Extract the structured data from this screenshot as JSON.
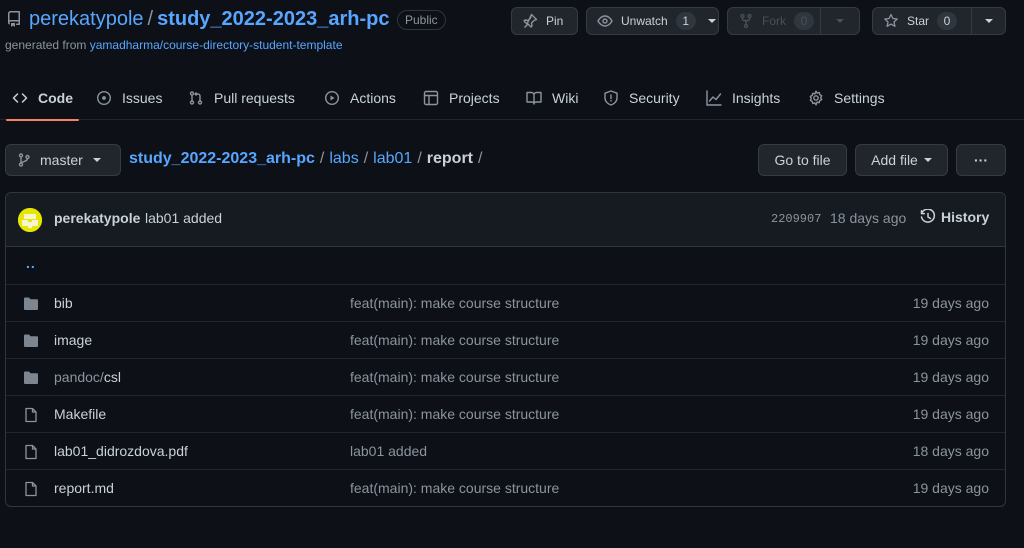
{
  "repo": {
    "owner": "perekatypole",
    "separator": "/",
    "name": "study_2022-2023_arh-pc",
    "visibility": "Public",
    "generated_prefix": "generated from ",
    "template": "yamadharma/course-directory-student-template"
  },
  "actions": {
    "pin": "Pin",
    "watch": "Unwatch",
    "watch_count": "1",
    "fork": "Fork",
    "fork_count": "0",
    "star": "Star",
    "star_count": "0"
  },
  "nav": {
    "tabs": [
      {
        "label": "Code",
        "icon": "code-icon",
        "active": true
      },
      {
        "label": "Issues",
        "icon": "issue-icon"
      },
      {
        "label": "Pull requests",
        "icon": "pull-request-icon"
      },
      {
        "label": "Actions",
        "icon": "play-icon"
      },
      {
        "label": "Projects",
        "icon": "table-icon"
      },
      {
        "label": "Wiki",
        "icon": "book-icon"
      },
      {
        "label": "Security",
        "icon": "shield-icon"
      },
      {
        "label": "Insights",
        "icon": "graph-icon"
      },
      {
        "label": "Settings",
        "icon": "gear-icon"
      }
    ]
  },
  "filenav": {
    "branch": "master",
    "breadcrumb": {
      "repo": "study_2022-2023_arh-pc",
      "path1": "labs",
      "path2": "lab01",
      "current": "report",
      "sep": "/"
    },
    "go_to_file": "Go to file",
    "add_file": "Add file",
    "more": "···"
  },
  "commit": {
    "author": "perekatypole",
    "message": "lab01 added",
    "sha": "2209907",
    "age": "18 days ago",
    "history": "History"
  },
  "files": {
    "updir": "..",
    "rows": [
      {
        "type": "dir",
        "name": "bib",
        "message": "feat(main): make course structure",
        "age": "19 days ago"
      },
      {
        "type": "dir",
        "name": "image",
        "message": "feat(main): make course structure",
        "age": "19 days ago"
      },
      {
        "type": "dir",
        "prefix": "pandoc/",
        "name": "csl",
        "message": "feat(main): make course structure",
        "age": "19 days ago"
      },
      {
        "type": "file",
        "name": "Makefile",
        "message": "feat(main): make course structure",
        "age": "19 days ago"
      },
      {
        "type": "file",
        "name": "lab01_didrozdova.pdf",
        "message": "lab01 added",
        "age": "18 days ago"
      },
      {
        "type": "file",
        "name": "report.md",
        "message": "feat(main): make course structure",
        "age": "19 days ago"
      }
    ]
  },
  "colors": {
    "background": "#0d1117",
    "link": "#58a6ff",
    "text": "#c9d1d9",
    "muted": "#8b949e",
    "tab_underline": "#f78166",
    "folder": "#7d8590"
  }
}
